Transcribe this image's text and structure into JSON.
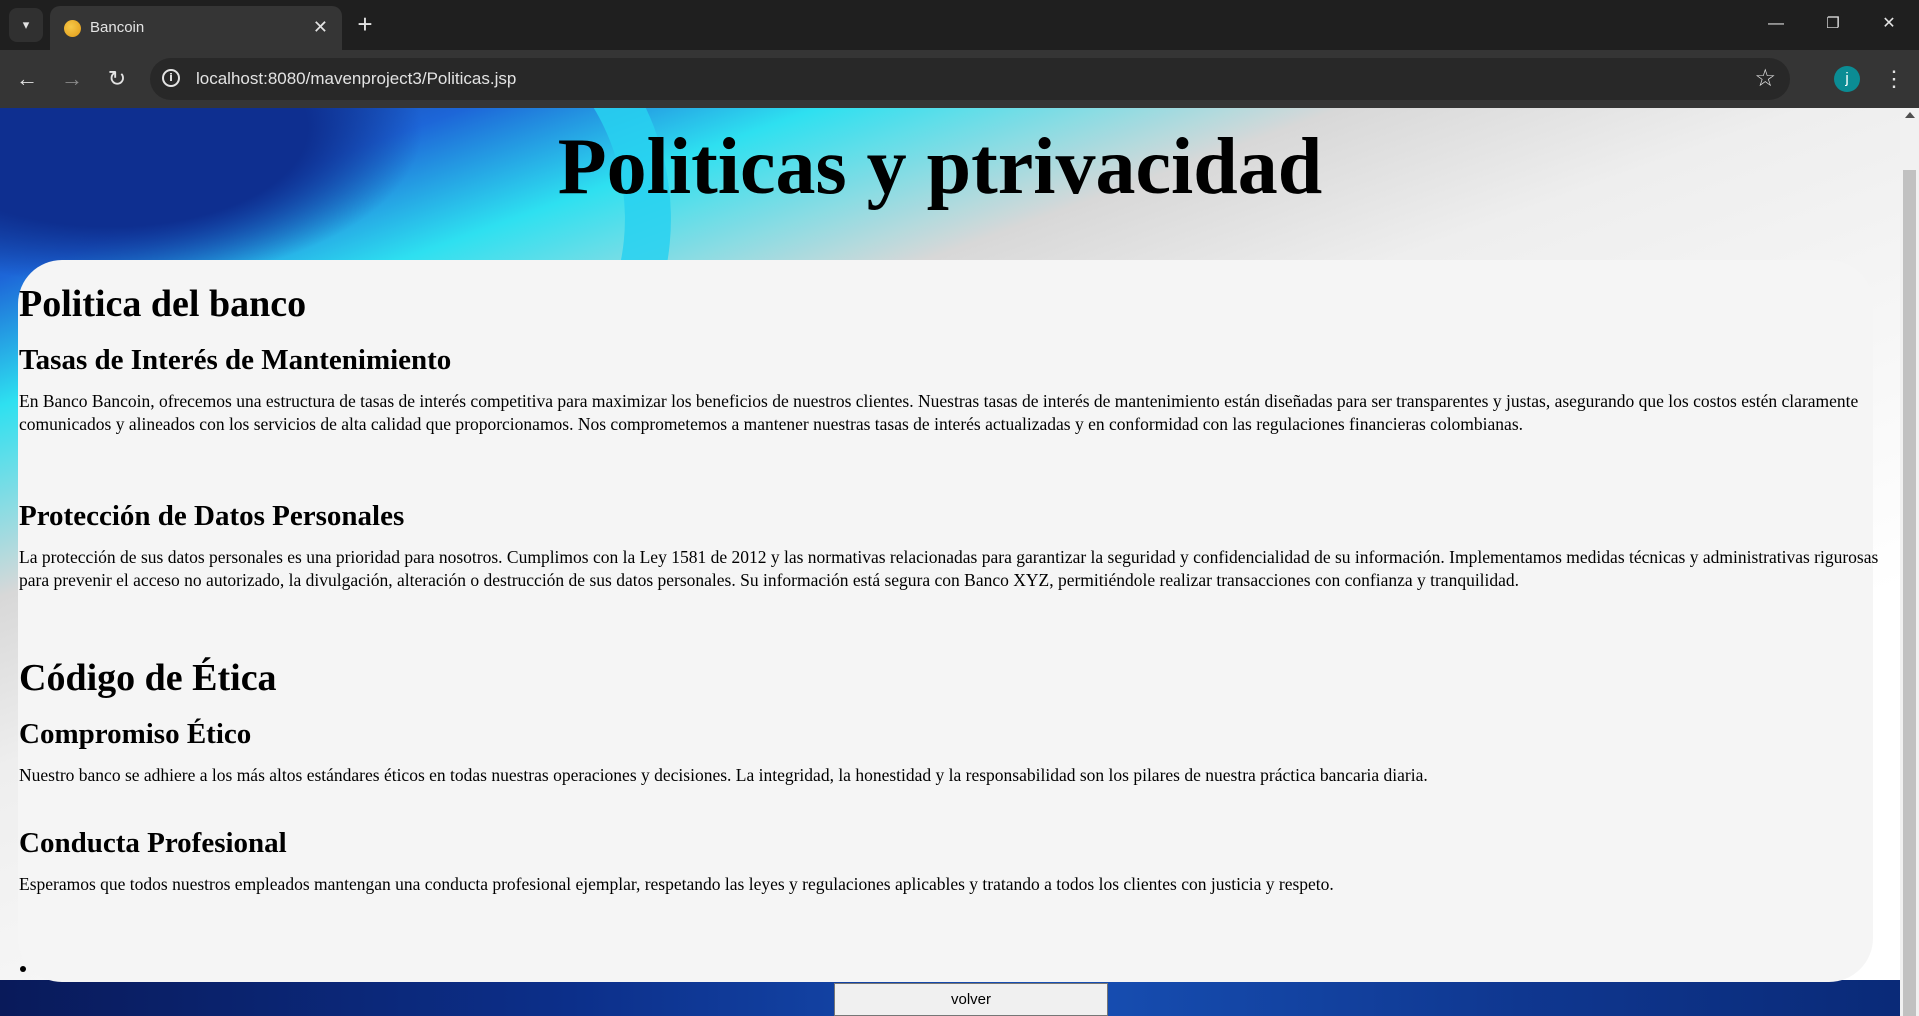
{
  "browser": {
    "tab_title": "Bancoin",
    "url": "localhost:8080/mavenproject3/Politicas.jsp",
    "profile_initial": "j",
    "icons": [
      "tab-search-icon",
      "favicon-icon",
      "close-icon",
      "plus-icon",
      "minimize-icon",
      "restore-icon",
      "close-window-icon",
      "back-icon",
      "forward-icon",
      "reload-icon",
      "info-icon",
      "star-icon",
      "kebab-menu-icon"
    ],
    "window_controls": {
      "minimize": "—",
      "restore": "❐",
      "close": "✕"
    }
  },
  "page": {
    "title": "Politicas y ptrivacidad",
    "sections": [
      {
        "heading": "Politica del banco",
        "subsections": [
          {
            "heading": "Tasas de Interés de Mantenimiento",
            "text": "En Banco Bancoin, ofrecemos una estructura de tasas de interés competitiva para maximizar los beneficios de nuestros clientes. Nuestras tasas de interés de mantenimiento están diseñadas para ser transparentes y justas, asegurando que los costos estén claramente comunicados y alineados con los servicios de alta calidad que proporcionamos. Nos comprometemos a mantener nuestras tasas de interés actualizadas y en conformidad con las regulaciones financieras colombianas."
          },
          {
            "heading": "Protección de Datos Personales",
            "text": "La protección de sus datos personales es una prioridad para nosotros. Cumplimos con la Ley 1581 de 2012 y las normativas relacionadas para garantizar la seguridad y confidencialidad de su información. Implementamos medidas técnicas y administrativas rigurosas para prevenir el acceso no autorizado, la divulgación, alteración o destrucción de sus datos personales. Su información está segura con Banco XYZ, permitiéndole realizar transacciones con confianza y tranquilidad."
          }
        ]
      },
      {
        "heading": "Código de Ética",
        "subsections": [
          {
            "heading": "Compromiso Ético",
            "text": "Nuestro banco se adhiere a los más altos estándares éticos en todas nuestras operaciones y decisiones. La integridad, la honestidad y la responsabilidad son los pilares de nuestra práctica bancaria diaria."
          },
          {
            "heading": "Conducta Profesional",
            "text": "Esperamos que todos nuestros empleados mantengan una conducta profesional ejemplar, respetando las leyes y regulaciones aplicables y tratando a todos los clientes con justicia y respeto."
          }
        ]
      }
    ],
    "back_button_label": "volver"
  }
}
